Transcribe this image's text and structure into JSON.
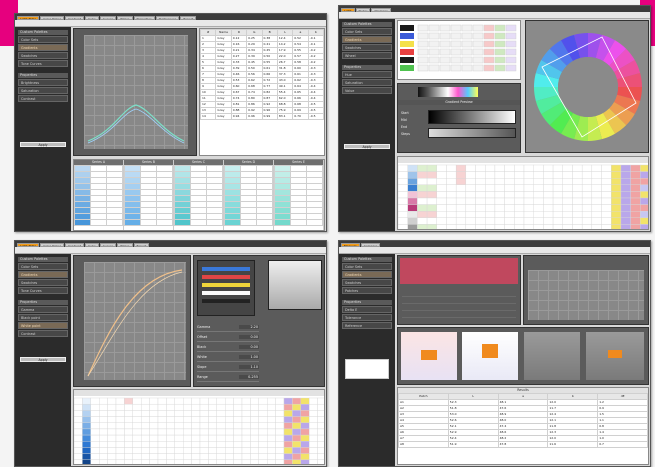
{
  "brand_color": "#e6007e",
  "accent": "#f39d1b",
  "panels": {
    "tl": {
      "tabs": [
        "Light Table",
        "Color Picker",
        "Gradient",
        "Cube",
        "Curves",
        "Tables",
        "Properties",
        "Preferences",
        "Export"
      ],
      "sidebar": {
        "heading1": "Custom Palettes",
        "items1": [
          "Color Sets",
          "Gradients",
          "Swatches",
          "Tone Curves"
        ],
        "heading2": "Properties",
        "items2": [
          "Brightness",
          "Saturation",
          "Contrast"
        ],
        "button": "Apply"
      },
      "table_headers": [
        "#",
        "Name",
        "R",
        "G",
        "B",
        "L",
        "a",
        "b"
      ],
      "table_rows": [
        [
          "1",
          "Gray",
          "0.12",
          "0.25",
          "0.38",
          "12.4",
          "0.52",
          "-0.1"
        ],
        [
          "2",
          "Gray",
          "0.16",
          "0.29",
          "0.41",
          "14.2",
          "0.54",
          "-0.1"
        ],
        [
          "3",
          "Gray",
          "0.21",
          "0.34",
          "0.45",
          "17.9",
          "0.55",
          "-0.2"
        ],
        [
          "4",
          "Gray",
          "0.27",
          "0.39",
          "0.50",
          "22.0",
          "0.57",
          "-0.2"
        ],
        [
          "5",
          "Gray",
          "0.33",
          "0.45",
          "0.55",
          "26.7",
          "0.58",
          "-0.2"
        ],
        [
          "6",
          "Gray",
          "0.39",
          "0.50",
          "0.61",
          "31.8",
          "0.60",
          "-0.3"
        ],
        [
          "7",
          "Gray",
          "0.46",
          "0.56",
          "0.66",
          "37.3",
          "0.61",
          "-0.3"
        ],
        [
          "8",
          "Gray",
          "0.53",
          "0.62",
          "0.72",
          "43.0",
          "0.62",
          "-0.3"
        ],
        [
          "9",
          "Gray",
          "0.60",
          "0.68",
          "0.77",
          "49.1",
          "0.64",
          "-0.4"
        ],
        [
          "10",
          "Gray",
          "0.67",
          "0.74",
          "0.82",
          "55.4",
          "0.65",
          "-0.4"
        ],
        [
          "11",
          "Gray",
          "0.74",
          "0.80",
          "0.87",
          "62.0",
          "0.66",
          "-0.4"
        ],
        [
          "12",
          "Gray",
          "0.81",
          "0.86",
          "0.92",
          "68.8",
          "0.68",
          "-0.5"
        ],
        [
          "13",
          "Gray",
          "0.88",
          "0.92",
          "0.96",
          "75.9",
          "0.69",
          "-0.5"
        ],
        [
          "14",
          "Gray",
          "0.94",
          "0.96",
          "0.99",
          "83.1",
          "0.70",
          "-0.5"
        ]
      ],
      "group_headers": [
        "Series A",
        "Series B",
        "Series C",
        "Series D",
        "Series E"
      ]
    },
    "tr": {
      "tabs": [
        "Light",
        "Picker",
        "Harmony"
      ],
      "sidebar": {
        "heading1": "Custom Palettes",
        "items1": [
          "Color Sets",
          "Gradients",
          "Swatches",
          "Wheel"
        ],
        "heading2": "Properties",
        "items2": [
          "Hue",
          "Saturation",
          "Value"
        ],
        "button": "Apply"
      },
      "group_title": "Gradient Preview",
      "labels": [
        "Start",
        "Mid",
        "End",
        "Steps"
      ]
    },
    "bl": {
      "tabs": [
        "Light Table",
        "Color Picker",
        "Gradient",
        "Cube",
        "Curves",
        "Tables",
        "Export"
      ],
      "sidebar": {
        "heading1": "Custom Palettes",
        "items1": [
          "Color Sets",
          "Gradients",
          "Swatches",
          "Tone Curves"
        ],
        "heading2": "Properties",
        "items2": [
          "Gamma",
          "Black point",
          "White point",
          "Contrast"
        ],
        "button": "Apply"
      },
      "fields": [
        "Gamma",
        "Offset",
        "Black",
        "White",
        "Slope",
        "Range"
      ],
      "values": [
        "2.20",
        "0.00",
        "0.00",
        "1.00",
        "1.10",
        "0-255"
      ]
    },
    "br": {
      "tabs": [
        "Measure",
        "Compare"
      ],
      "sidebar": {
        "heading1": "Custom Palettes",
        "items1": [
          "Color Sets",
          "Gradients",
          "Swatches",
          "Patches"
        ],
        "heading2": "Properties",
        "items2": [
          "Delta E",
          "Tolerance",
          "Reference"
        ],
        "button": "Apply"
      },
      "table_title": "Results",
      "table_headers": [
        "Patch",
        "L",
        "a",
        "b",
        "dE"
      ],
      "rows": [
        [
          "A1",
          "52.3",
          "48.1",
          "12.0",
          "1.2"
        ],
        [
          "A2",
          "51.8",
          "47.6",
          "11.7",
          "0.9"
        ],
        [
          "A3",
          "53.0",
          "48.9",
          "12.4",
          "1.5"
        ],
        [
          "A4",
          "52.6",
          "48.0",
          "12.1",
          "1.1"
        ],
        [
          "A5",
          "52.1",
          "47.4",
          "11.8",
          "0.8"
        ],
        [
          "A6",
          "52.9",
          "48.6",
          "12.3",
          "1.4"
        ],
        [
          "A7",
          "52.4",
          "48.2",
          "12.0",
          "1.0"
        ],
        [
          "A8",
          "51.9",
          "47.8",
          "11.6",
          "0.7"
        ]
      ]
    }
  }
}
